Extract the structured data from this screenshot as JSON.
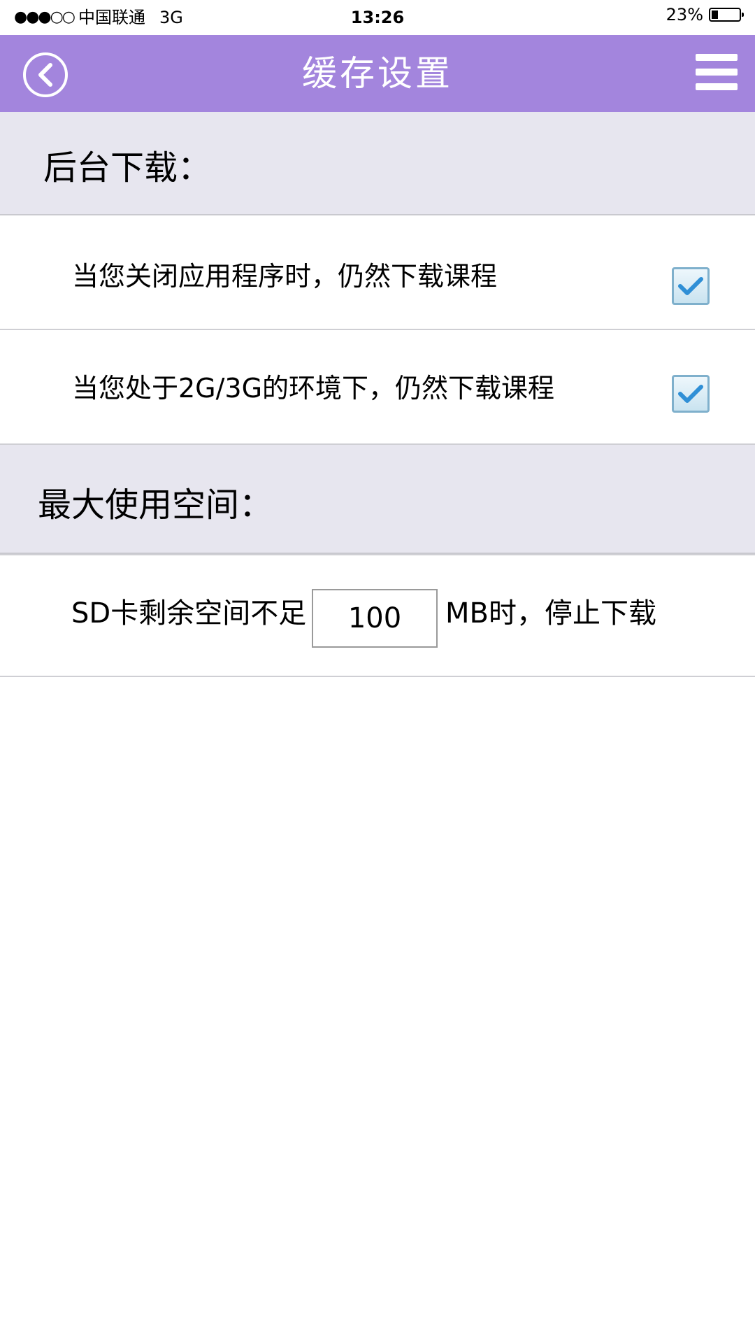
{
  "status_bar": {
    "signal": "●●●○○",
    "carrier": "中国联通",
    "network": "3G",
    "time": "13:26",
    "battery_text": "23%",
    "battery_level_percent": 23
  },
  "nav": {
    "title": "缓存设置",
    "back_icon": "chevron-left-circle-icon",
    "menu_icon": "hamburger-menu-icon",
    "bar_color": "#a385dd"
  },
  "sections": {
    "background_download": {
      "title": "后台下载：",
      "options": [
        {
          "label": "当您关闭应用程序时，仍然下载课程",
          "checked": true
        },
        {
          "label": "当您处于2G/3G的环境下，仍然下载课程",
          "checked": true
        }
      ]
    },
    "max_space": {
      "title": "最大使用空间：",
      "prefix": "SD卡剩余空间不足",
      "value": "100",
      "suffix": "MB时，停止下载"
    }
  }
}
